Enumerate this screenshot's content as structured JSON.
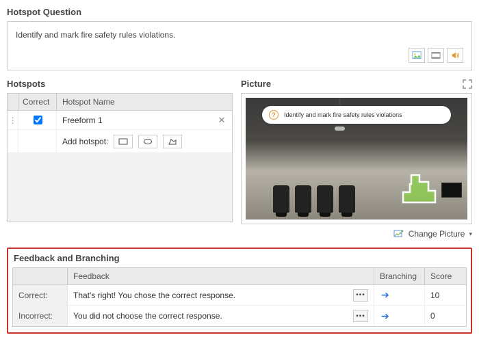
{
  "question": {
    "title": "Hotspot Question",
    "text": "Identify and mark fire safety rules violations."
  },
  "hotspots": {
    "title": "Hotspots",
    "headers": {
      "correct": "Correct",
      "name": "Hotspot Name"
    },
    "rows": [
      {
        "correct": true,
        "name": "Freeform 1"
      }
    ],
    "add_label": "Add hotspot:"
  },
  "picture": {
    "title": "Picture",
    "tooltip_text": "Identify and mark fire safety rules violations",
    "change_label": "Change Picture"
  },
  "feedback": {
    "title": "Feedback and Branching",
    "headers": {
      "feedback": "Feedback",
      "branching": "Branching",
      "score": "Score"
    },
    "rows": [
      {
        "label": "Correct:",
        "text": "That's right! You chose the correct response.",
        "score": "10"
      },
      {
        "label": "Incorrect:",
        "text": "You did not choose the correct response.",
        "score": "0"
      }
    ]
  }
}
